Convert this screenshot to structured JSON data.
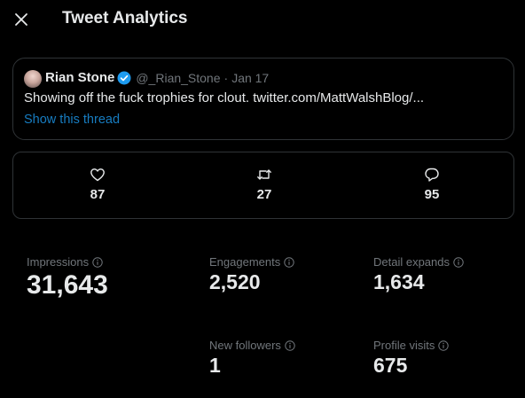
{
  "header": {
    "title": "Tweet Analytics"
  },
  "tweet": {
    "author_name": "Rian Stone",
    "handle": "@_Rian_Stone",
    "separator": "·",
    "date": "Jan 17",
    "text": "Showing off the fuck trophies for clout. twitter.com/MattWalshBlog/...",
    "thread_link": "Show this thread"
  },
  "engagement_counts": {
    "likes": "87",
    "retweets": "27",
    "replies": "95"
  },
  "stats": {
    "impressions": {
      "label": "Impressions",
      "value": "31,643"
    },
    "engagements": {
      "label": "Engagements",
      "value": "2,520"
    },
    "detail_expands": {
      "label": "Detail expands",
      "value": "1,634"
    },
    "new_followers": {
      "label": "New followers",
      "value": "1"
    },
    "profile_visits": {
      "label": "Profile visits",
      "value": "675"
    }
  },
  "colors": {
    "background": "#000000",
    "text": "#e7e9ea",
    "muted": "#71767b",
    "accent": "#1d9bf0",
    "border": "#2f3336"
  }
}
